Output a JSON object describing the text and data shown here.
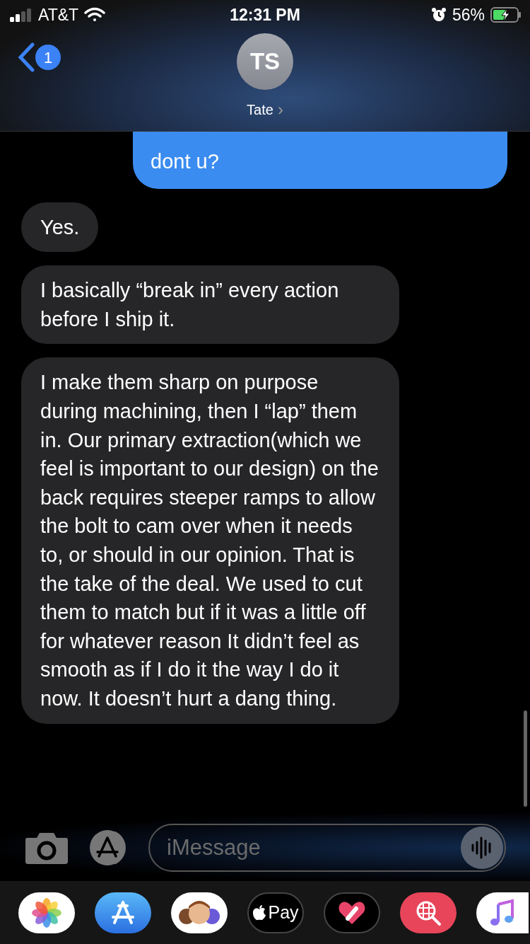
{
  "status_bar": {
    "carrier": "AT&T",
    "time": "12:31 PM",
    "battery": "56%"
  },
  "header": {
    "back_badge": "1",
    "avatar_initials": "TS",
    "contact_name": "Tate",
    "chevron": "›"
  },
  "messages": [
    {
      "kind": "sent",
      "text": "dont u?"
    },
    {
      "kind": "received",
      "text": "Yes."
    },
    {
      "kind": "received",
      "text": "I basically “break in” every action before I ship it."
    },
    {
      "kind": "received",
      "text": "I make them sharp on purpose during machining, then I “lap” them in. Our primary extraction(which we feel is important to our design) on the back requires steeper ramps to allow the bolt to cam over when it needs to, or should in our opinion. That is the take of the deal. We used to cut them to match but if it was a little off for whatever reason It didn’t feel as smooth as if I do it the way I do it now. It doesn’t hurt a dang thing."
    }
  ],
  "composer": {
    "placeholder": "iMessage"
  },
  "app_drawer": [
    {
      "kind": "photos"
    },
    {
      "kind": "appstore"
    },
    {
      "kind": "memoji"
    },
    {
      "kind": "pay",
      "label": "Pay"
    },
    {
      "kind": "heart"
    },
    {
      "kind": "search"
    },
    {
      "kind": "music"
    }
  ]
}
